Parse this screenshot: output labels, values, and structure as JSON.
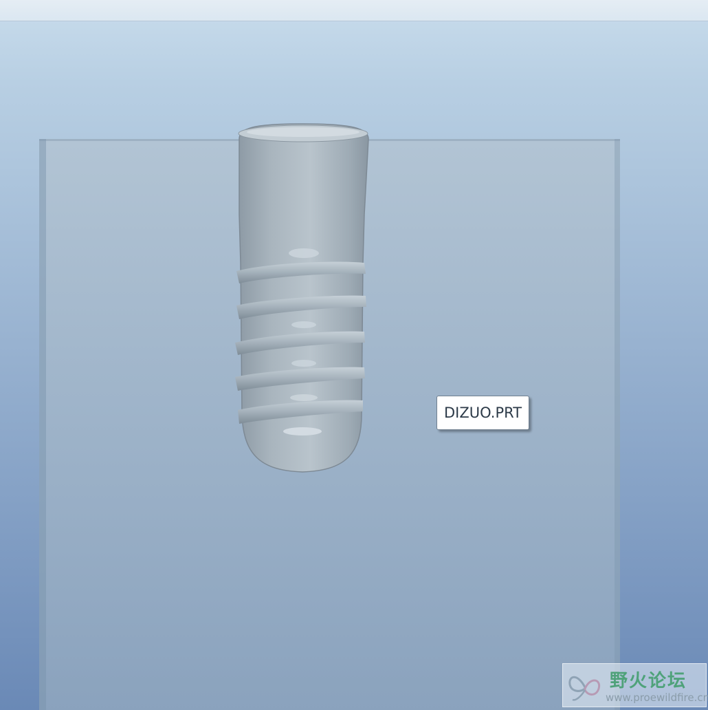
{
  "viewport": {
    "part_tooltip": "DIZUO.PRT"
  },
  "watermark": {
    "title": "野火论坛",
    "url": "www.proewildfire.cn",
    "logo_icon": "butterfly-logo-icon"
  },
  "colors": {
    "background_top": "#c8dcec",
    "background_bottom": "#6a89b6",
    "block": "#a1b6cb",
    "model": "#a7b3bd",
    "watermark_text": "#4fa27a"
  }
}
